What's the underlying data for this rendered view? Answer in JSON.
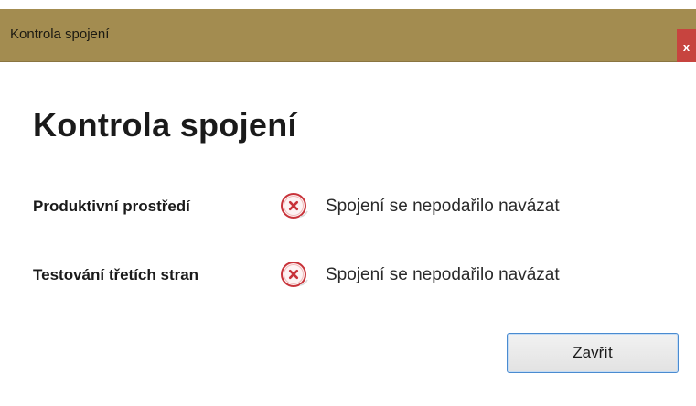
{
  "window": {
    "title": "Kontrola spojení",
    "close_label": "x"
  },
  "main": {
    "heading": "Kontrola spojení",
    "rows": [
      {
        "label": "Produktivní prostředí",
        "status_icon": "error-icon",
        "status_text": "Spojení se nepodařilo navázat"
      },
      {
        "label": "Testování třetích stran",
        "status_icon": "error-icon",
        "status_text": "Spojení se nepodařilo navázat"
      }
    ],
    "close_button_label": "Zavřít"
  },
  "colors": {
    "titlebar": "#a38c50",
    "close_button": "#c7443f",
    "error_icon": "#c8333a",
    "button_border": "#4a8bd0"
  }
}
